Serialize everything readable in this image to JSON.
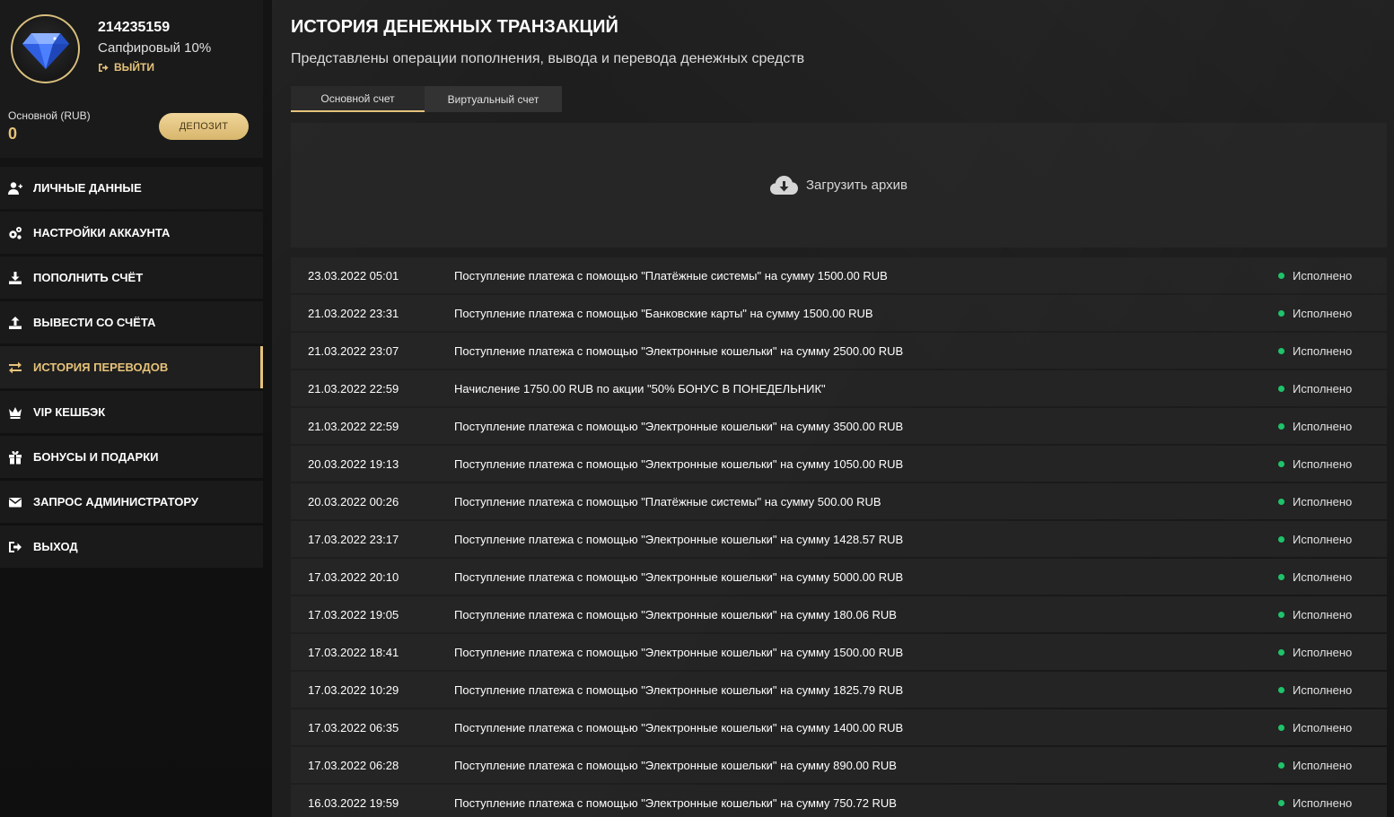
{
  "profile": {
    "user_id": "214235159",
    "level": "Сапфировый 10%",
    "logout_label": "ВЫЙТИ",
    "balance_label": "Основной (RUB)",
    "balance_value": "0",
    "deposit_label": "ДЕПОЗИТ"
  },
  "menu": {
    "items": [
      {
        "label": "ЛИЧНЫЕ ДАННЫЕ",
        "icon": "user-plus-icon"
      },
      {
        "label": "НАСТРОЙКИ АККАУНТА",
        "icon": "gears-icon"
      },
      {
        "label": "ПОПОЛНИТЬ СЧЁТ",
        "icon": "download-icon"
      },
      {
        "label": "ВЫВЕСТИ СО СЧЁТА",
        "icon": "upload-icon"
      },
      {
        "label": "ИСТОРИЯ ПЕРЕВОДОВ",
        "icon": "exchange-icon",
        "active": true
      },
      {
        "label": "VIP КЕШБЭК",
        "icon": "crown-icon"
      },
      {
        "label": "БОНУСЫ И ПОДАРКИ",
        "icon": "gift-icon"
      },
      {
        "label": "ЗАПРОС АДМИНИСТРАТОРУ",
        "icon": "envelope-icon"
      },
      {
        "label": "ВЫХОД",
        "icon": "sign-out-icon"
      }
    ]
  },
  "main": {
    "title": "ИСТОРИЯ ДЕНЕЖНЫХ ТРАНЗАКЦИЙ",
    "subtitle": "Представлены операции пополнения, вывода и перевода денежных средств",
    "tabs": [
      {
        "label": "Основной счет",
        "active": true
      },
      {
        "label": "Виртуальный счет",
        "active": false
      }
    ],
    "archive_label": "Загрузить архив"
  },
  "colors": {
    "accent": "#e6c27a",
    "status_ok": "#1fc36a"
  },
  "transactions": [
    {
      "date": "23.03.2022 05:01",
      "description": "Поступление платежа с помощью \"Платёжные системы\" на сумму 1500.00 RUB",
      "status": "Исполнено"
    },
    {
      "date": "21.03.2022 23:31",
      "description": "Поступление платежа с помощью \"Банковские карты\" на сумму 1500.00 RUB",
      "status": "Исполнено"
    },
    {
      "date": "21.03.2022 23:07",
      "description": "Поступление платежа с помощью \"Электронные кошельки\" на сумму 2500.00 RUB",
      "status": "Исполнено"
    },
    {
      "date": "21.03.2022 22:59",
      "description": "Начисление 1750.00 RUB по акции \"50% БОНУС В ПОНЕДЕЛЬНИК\"",
      "status": "Исполнено"
    },
    {
      "date": "21.03.2022 22:59",
      "description": "Поступление платежа с помощью \"Электронные кошельки\" на сумму 3500.00 RUB",
      "status": "Исполнено"
    },
    {
      "date": "20.03.2022 19:13",
      "description": "Поступление платежа с помощью \"Электронные кошельки\" на сумму 1050.00 RUB",
      "status": "Исполнено"
    },
    {
      "date": "20.03.2022 00:26",
      "description": "Поступление платежа с помощью \"Платёжные системы\" на сумму 500.00 RUB",
      "status": "Исполнено"
    },
    {
      "date": "17.03.2022 23:17",
      "description": "Поступление платежа с помощью \"Электронные кошельки\" на сумму 1428.57 RUB",
      "status": "Исполнено"
    },
    {
      "date": "17.03.2022 20:10",
      "description": "Поступление платежа с помощью \"Электронные кошельки\" на сумму 5000.00 RUB",
      "status": "Исполнено"
    },
    {
      "date": "17.03.2022 19:05",
      "description": "Поступление платежа с помощью \"Электронные кошельки\" на сумму 180.06 RUB",
      "status": "Исполнено"
    },
    {
      "date": "17.03.2022 18:41",
      "description": "Поступление платежа с помощью \"Электронные кошельки\" на сумму 1500.00 RUB",
      "status": "Исполнено"
    },
    {
      "date": "17.03.2022 10:29",
      "description": "Поступление платежа с помощью \"Электронные кошельки\" на сумму 1825.79 RUB",
      "status": "Исполнено"
    },
    {
      "date": "17.03.2022 06:35",
      "description": "Поступление платежа с помощью \"Электронные кошельки\" на сумму 1400.00 RUB",
      "status": "Исполнено"
    },
    {
      "date": "17.03.2022 06:28",
      "description": "Поступление платежа с помощью \"Электронные кошельки\" на сумму 890.00 RUB",
      "status": "Исполнено"
    },
    {
      "date": "16.03.2022 19:59",
      "description": "Поступление платежа с помощью \"Электронные кошельки\" на сумму 750.72 RUB",
      "status": "Исполнено"
    }
  ]
}
